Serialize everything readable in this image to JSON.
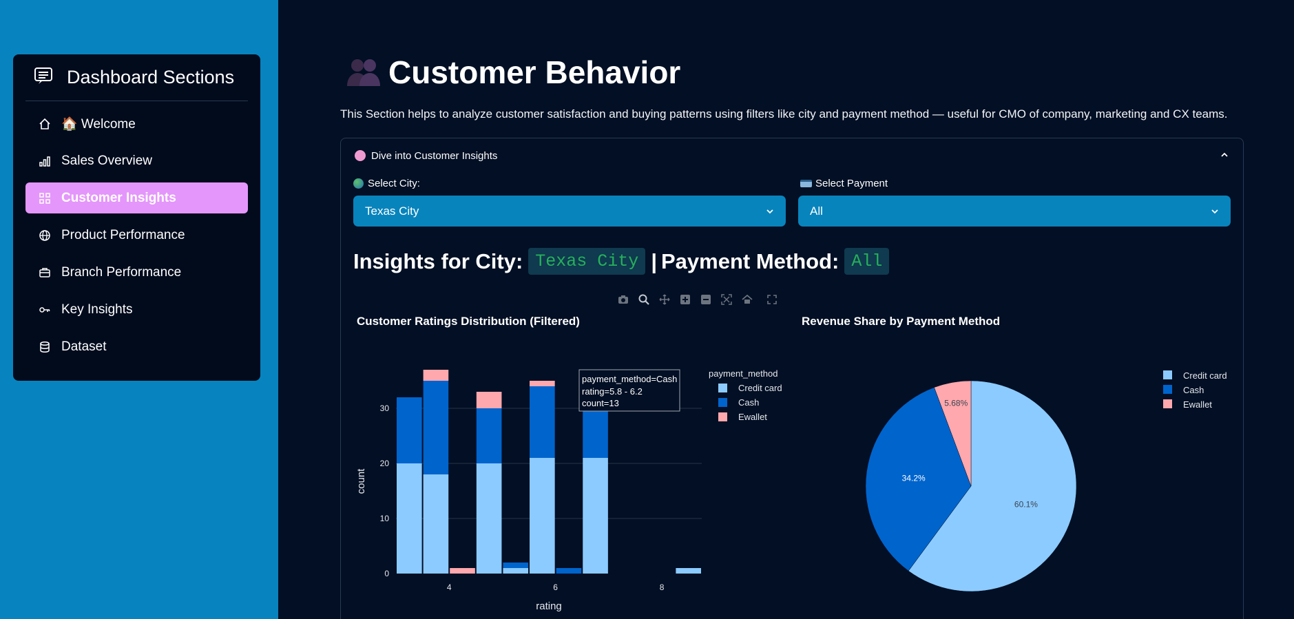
{
  "sidebar": {
    "title": "Dashboard Sections",
    "items": [
      {
        "label": "🏠 Welcome",
        "icon": "home-icon"
      },
      {
        "label": "Sales Overview",
        "icon": "bar-chart-icon"
      },
      {
        "label": "Customer Insights",
        "icon": "grid-icon",
        "active": true
      },
      {
        "label": "Product Performance",
        "icon": "globe-icon"
      },
      {
        "label": "Branch Performance",
        "icon": "briefcase-icon"
      },
      {
        "label": "Key Insights",
        "icon": "key-icon"
      },
      {
        "label": "Dataset",
        "icon": "database-icon"
      }
    ]
  },
  "page": {
    "title": "Customer Behavior",
    "description": "This Section helps to analyze customer satisfaction and buying patterns using filters like city and payment method — useful for CMO of company, marketing and CX teams."
  },
  "expander": {
    "label": "Dive into Customer Insights"
  },
  "filters": {
    "city_label": "Select City:",
    "city_value": "Texas City",
    "payment_label": "Select Payment",
    "payment_value": "All"
  },
  "insights": {
    "prefix": "Insights for City:",
    "city": "Texas City",
    "separator": "|",
    "payment_prefix": "Payment Method:",
    "payment": "All"
  },
  "colors": {
    "credit_card": "#8ccbff",
    "cash": "#0064cd",
    "ewallet": "#ffa8ad",
    "accent": "#e496fb",
    "select_bg": "#0884bd"
  },
  "chart_data": [
    {
      "type": "bar",
      "title": "Customer Ratings Distribution (Filtered)",
      "xlabel": "rating",
      "ylabel": "count",
      "legend_title": "payment_method",
      "x": [
        3.5,
        4.5,
        5.5,
        6.5,
        7.5,
        8.5
      ],
      "xlim": [
        3.0,
        8.75
      ],
      "ylim": [
        0,
        38
      ],
      "xticks": [
        4,
        6,
        8
      ],
      "yticks": [
        0,
        10,
        20,
        30
      ],
      "bin_width": 0.5,
      "bins": [
        {
          "x": 3.25,
          "credit": 20,
          "cash": 12,
          "ewallet": 0
        },
        {
          "x": 3.75,
          "credit": 18,
          "cash": 17,
          "ewallet": 2
        },
        {
          "x": 4.25,
          "credit": 0,
          "cash": 0,
          "ewallet": 1
        },
        {
          "x": 4.75,
          "credit": 20,
          "cash": 10,
          "ewallet": 3
        },
        {
          "x": 5.25,
          "credit": 1,
          "cash": 1,
          "ewallet": 0
        },
        {
          "x": 5.75,
          "credit": 21,
          "cash": 13,
          "ewallet": 1
        },
        {
          "x": 6.25,
          "credit": 0,
          "cash": 1,
          "ewallet": 0
        },
        {
          "x": 6.75,
          "credit": 21,
          "cash": 9,
          "ewallet": 0
        },
        {
          "x": 8.5,
          "credit": 1,
          "cash": 0,
          "ewallet": 0
        }
      ],
      "series": [
        {
          "name": "Credit card"
        },
        {
          "name": "Cash"
        },
        {
          "name": "Ewallet"
        }
      ],
      "tooltip": [
        "payment_method=Cash",
        "rating=5.8 - 6.2",
        "count=13"
      ]
    },
    {
      "type": "pie",
      "title": "Revenue Share by Payment Method",
      "labels": [
        "Credit card",
        "Cash",
        "Ewallet"
      ],
      "values": [
        60.1,
        34.2,
        5.68
      ],
      "value_labels": [
        "60.1%",
        "34.2%",
        "5.68%"
      ]
    }
  ]
}
